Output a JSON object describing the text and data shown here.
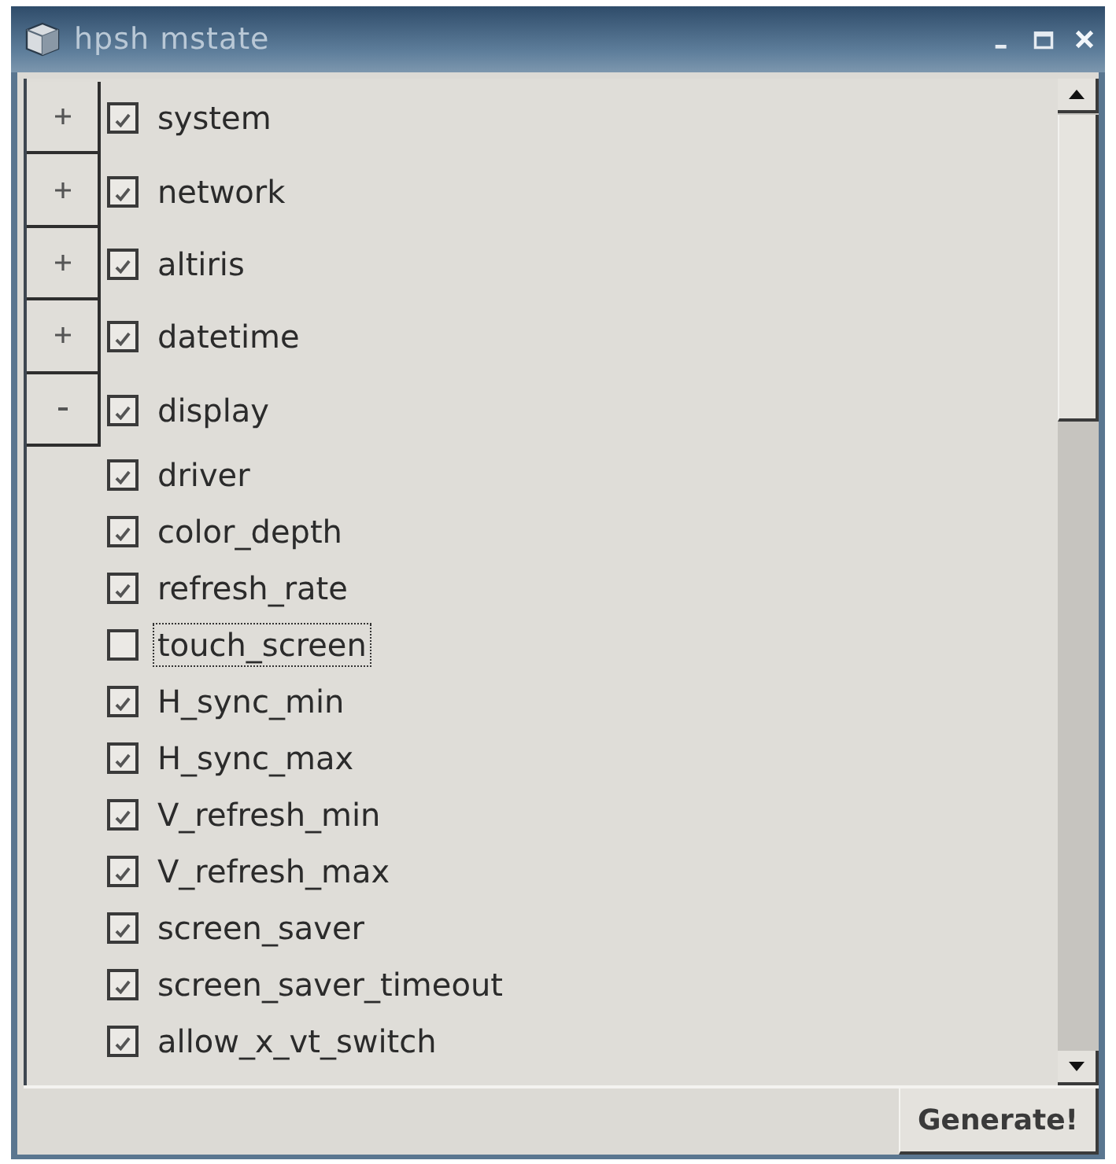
{
  "window": {
    "title": "hpsh mstate"
  },
  "tree": {
    "items": [
      {
        "label": "system",
        "checked": true,
        "expanded": false,
        "focused": false
      },
      {
        "label": "network",
        "checked": true,
        "expanded": false,
        "focused": false
      },
      {
        "label": "altiris",
        "checked": true,
        "expanded": false,
        "focused": false
      },
      {
        "label": "datetime",
        "checked": true,
        "expanded": false,
        "focused": false
      },
      {
        "label": "display",
        "checked": true,
        "expanded": true,
        "focused": false,
        "children": [
          {
            "label": "driver",
            "checked": true,
            "focused": false
          },
          {
            "label": "color_depth",
            "checked": true,
            "focused": false
          },
          {
            "label": "refresh_rate",
            "checked": true,
            "focused": false
          },
          {
            "label": "touch_screen",
            "checked": false,
            "focused": true
          },
          {
            "label": "H_sync_min",
            "checked": true,
            "focused": false
          },
          {
            "label": "H_sync_max",
            "checked": true,
            "focused": false
          },
          {
            "label": "V_refresh_min",
            "checked": true,
            "focused": false
          },
          {
            "label": "V_refresh_max",
            "checked": true,
            "focused": false
          },
          {
            "label": "screen_saver",
            "checked": true,
            "focused": false
          },
          {
            "label": "screen_saver_timeout",
            "checked": true,
            "focused": false
          },
          {
            "label": "allow_x_vt_switch",
            "checked": true,
            "focused": false
          }
        ]
      }
    ]
  },
  "generate_button": {
    "label": "Generate!"
  }
}
